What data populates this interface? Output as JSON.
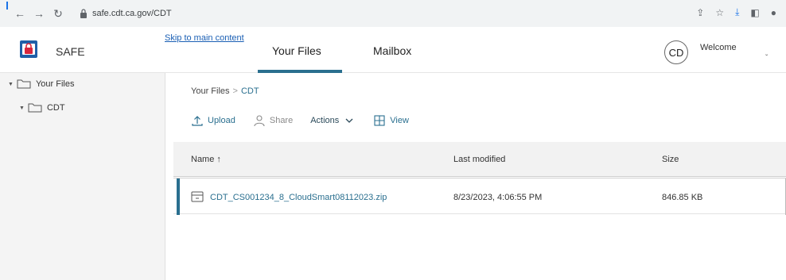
{
  "browser": {
    "url": "safe.cdt.ca.gov/CDT"
  },
  "header": {
    "brand": "SAFE",
    "skip_link": "Skip to main content",
    "tabs": [
      {
        "label": "Your Files",
        "active": true
      },
      {
        "label": "Mailbox",
        "active": false
      }
    ],
    "avatar_initials": "CD",
    "welcome": "Welcome"
  },
  "sidebar": {
    "root": "Your Files",
    "child": "CDT"
  },
  "breadcrumb": {
    "root": "Your Files",
    "separator": ">",
    "current": "CDT"
  },
  "toolbar": {
    "upload": "Upload",
    "share": "Share",
    "actions": "Actions",
    "view": "View"
  },
  "table": {
    "columns": [
      "Name ↑",
      "Last modified",
      "Size"
    ],
    "rows": [
      {
        "name": "CDT_CS001234_8_CloudSmart08112023.zip",
        "modified": "8/23/2023, 4:06:55 PM",
        "size": "846.85 KB"
      }
    ]
  },
  "colors": {
    "accent": "#2a6f8f",
    "link": "#1a5fb4",
    "logo_red": "#d7263d",
    "logo_blue": "#1f5fa8"
  }
}
